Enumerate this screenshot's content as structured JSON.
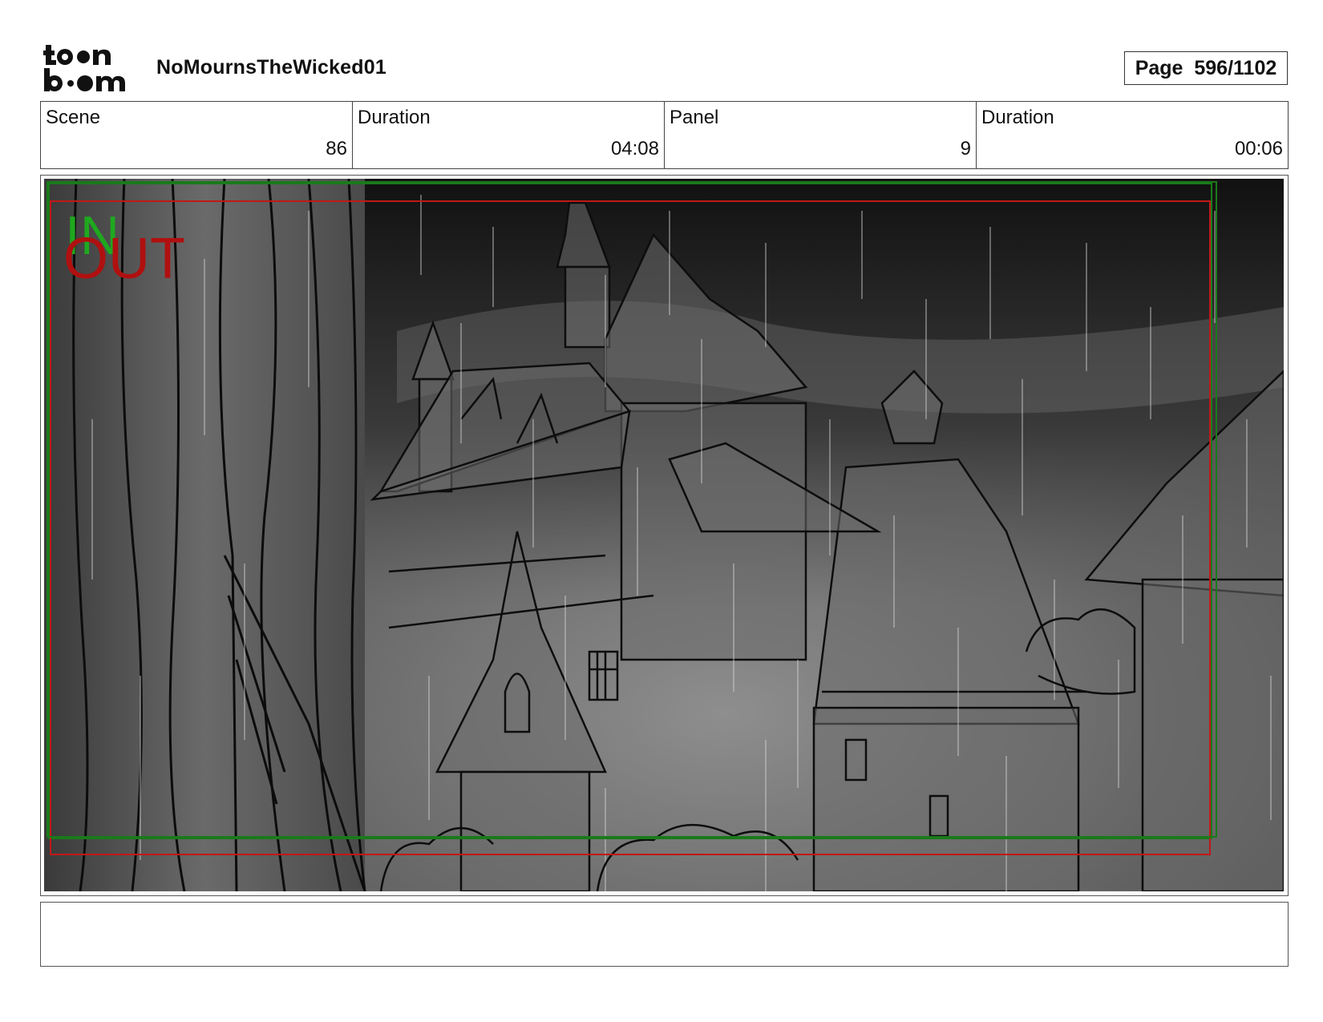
{
  "header": {
    "logo_text_line1": "toon",
    "logo_text_line2": "boom",
    "project_title": "NoMournsTheWicked01",
    "page_label": "Page",
    "page_value": "596/1102"
  },
  "info": {
    "scene_label": "Scene",
    "scene_value": "86",
    "scene_duration_label": "Duration",
    "scene_duration_value": "04:08",
    "panel_label": "Panel",
    "panel_value": "9",
    "panel_duration_label": "Duration",
    "panel_duration_value": "00:06"
  },
  "panel": {
    "in_marker": "IN",
    "out_marker": "OUT",
    "in_color": "#1fa81f",
    "out_color": "#b01010",
    "safe_frame_color": "#c01818",
    "title_safe_color": "#1a7a1a"
  },
  "notes": {
    "text": ""
  }
}
